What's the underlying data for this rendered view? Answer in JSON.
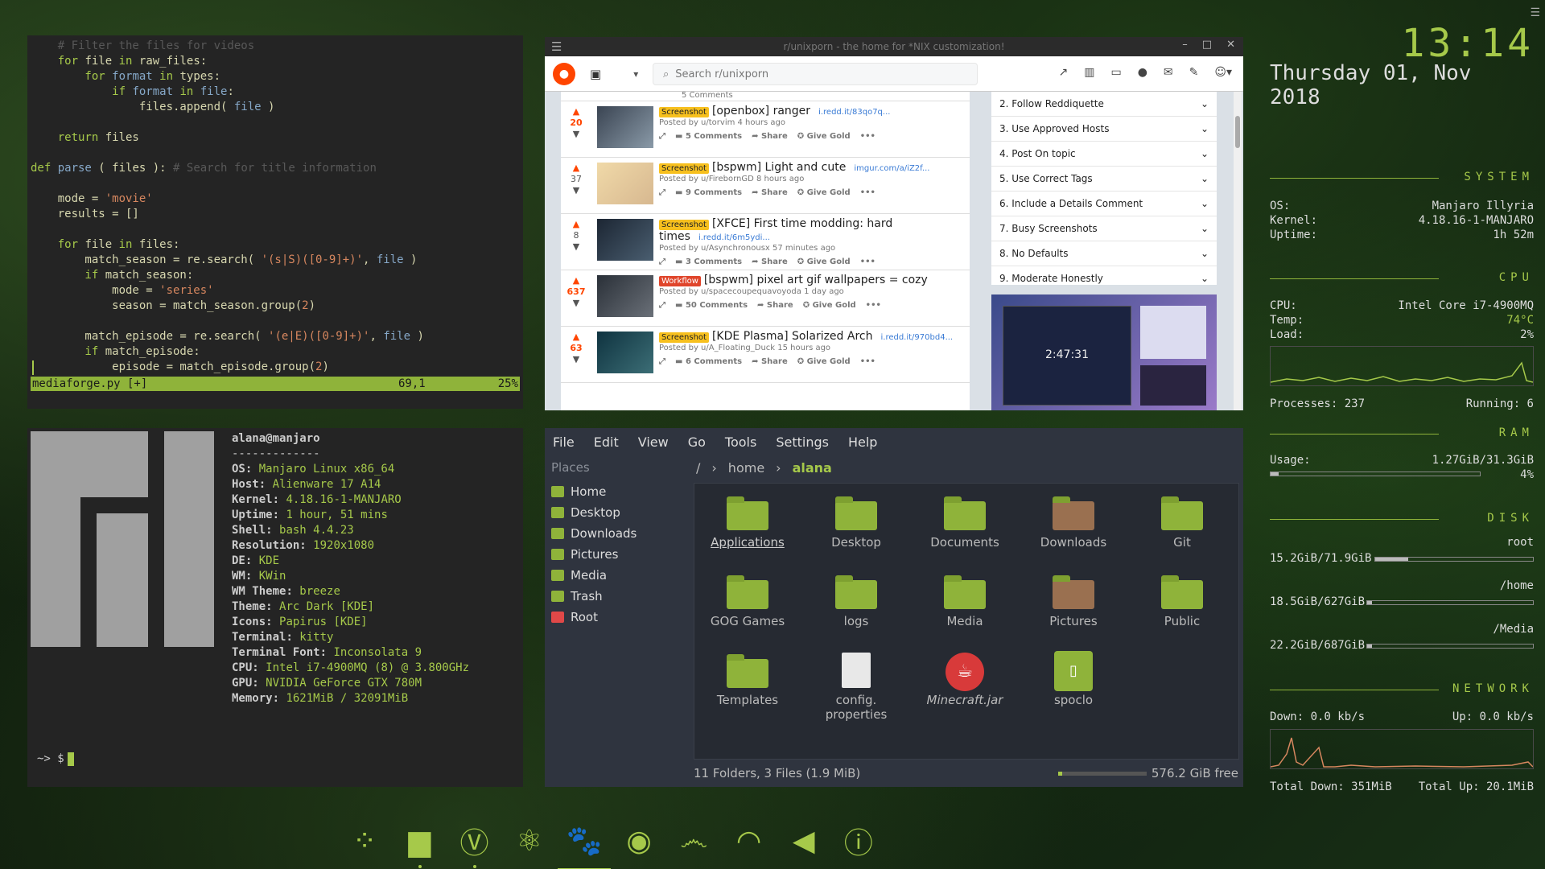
{
  "vim": {
    "lines": [
      [
        [
          "cm",
          "    # Filter the files for videos"
        ]
      ],
      [
        [
          "kw",
          "    for "
        ],
        [
          "",
          "file "
        ],
        [
          "kw",
          "in "
        ],
        [
          "",
          "raw_files:"
        ]
      ],
      [
        [
          "kw",
          "        for "
        ],
        [
          "fn",
          "format "
        ],
        [
          "kw",
          "in "
        ],
        [
          "",
          "types:"
        ]
      ],
      [
        [
          "kw",
          "            if "
        ],
        [
          "fn",
          "format "
        ],
        [
          "kw",
          "in "
        ],
        [
          "fn",
          "file"
        ],
        [
          "",
          ":"
        ]
      ],
      [
        [
          "",
          "                files.append( "
        ],
        [
          "fn",
          "file"
        ],
        [
          "",
          " )"
        ]
      ],
      [
        [
          "",
          ""
        ]
      ],
      [
        [
          "kw",
          "    return "
        ],
        [
          "",
          "files"
        ]
      ],
      [
        [
          "",
          ""
        ]
      ],
      [
        [
          "kw",
          "def "
        ],
        [
          "fn",
          "parse"
        ],
        [
          "",
          " ( files ): "
        ],
        [
          "cm",
          "# Search for title information"
        ]
      ],
      [
        [
          "",
          ""
        ]
      ],
      [
        [
          "",
          "    mode = "
        ],
        [
          "str",
          "'movie'"
        ]
      ],
      [
        [
          "",
          "    results = []"
        ]
      ],
      [
        [
          "",
          ""
        ]
      ],
      [
        [
          "kw",
          "    for "
        ],
        [
          "",
          "file "
        ],
        [
          "kw",
          "in "
        ],
        [
          "",
          "files:"
        ]
      ],
      [
        [
          "",
          "        match_season = re.search( "
        ],
        [
          "str",
          "'(s|S)([0-9]+)'"
        ],
        [
          "",
          ", "
        ],
        [
          "fn",
          "file"
        ],
        [
          "",
          " )"
        ]
      ],
      [
        [
          "kw",
          "        if "
        ],
        [
          "",
          "match_season:"
        ]
      ],
      [
        [
          "",
          "            mode = "
        ],
        [
          "str",
          "'series'"
        ]
      ],
      [
        [
          "",
          "            season = match_season.group("
        ],
        [
          "num",
          "2"
        ],
        [
          "",
          ")"
        ]
      ],
      [
        [
          "",
          ""
        ]
      ],
      [
        [
          "",
          "        match_episode = re.search( "
        ],
        [
          "str",
          "'(e|E)([0-9]+)'"
        ],
        [
          "",
          ", "
        ],
        [
          "fn",
          "file"
        ],
        [
          "",
          " )"
        ]
      ],
      [
        [
          "kw",
          "        if "
        ],
        [
          "",
          "match_episode:"
        ]
      ],
      [
        [
          "",
          "            episode = match_episode.group("
        ],
        [
          "num",
          "2"
        ],
        [
          "",
          ")"
        ]
      ]
    ],
    "status_file": "mediaforge.py [+]",
    "status_pos": "69,1",
    "status_pct": "25%"
  },
  "reddit": {
    "window_title": "r/unixporn - the home for *NIX customization!",
    "search_placeholder": "Search r/unixporn",
    "posts": [
      {
        "votes": "20",
        "hot": true,
        "flair": "Screenshot",
        "title": "[openbox] ranger",
        "domain": "i.redd.it/83qo7q...",
        "meta": "Posted by u/torvim 4 hours ago",
        "comments": "5 Comments"
      },
      {
        "votes": "37",
        "hot": false,
        "flair": "Screenshot",
        "title": "[bspwm] Light and cute",
        "domain": "imgur.com/a/iZ2f...",
        "meta": "Posted by u/FirebornGD 8 hours ago",
        "comments": "9 Comments"
      },
      {
        "votes": "8",
        "hot": false,
        "flair": "Screenshot",
        "title": "[XFCE] First time modding: hard times",
        "domain": "i.redd.it/6m5ydi...",
        "meta": "Posted by u/Asynchronousx 57 minutes ago",
        "comments": "3 Comments"
      },
      {
        "votes": "637",
        "hot": true,
        "flair": "Workflow",
        "title": "[bspwm] pixel art gif wallpapers = cozy",
        "domain": "",
        "meta": "Posted by u/spacecoupequavoyoda 1 day ago",
        "comments": "50 Comments"
      },
      {
        "votes": "63",
        "hot": true,
        "flair": "Screenshot",
        "title": "[KDE Plasma] Solarized Arch",
        "domain": "i.redd.it/970bd4...",
        "meta": "Posted by u/A_Floating_Duck 15 hours ago",
        "comments": "6 Comments"
      }
    ],
    "share": "Share",
    "give_gold": "Give Gold",
    "rules": [
      "2. Follow Reddiquette",
      "3. Use Approved Hosts",
      "4. Post On topic",
      "5. Use Correct Tags",
      "6. Include a Details Comment",
      "7. Busy Screenshots",
      "8. No Defaults",
      "9. Moderate Honestly"
    ],
    "banner_clock": "2:47:31",
    "top_partial_comments": "5 Comments"
  },
  "neofetch": {
    "user": "alana@manjaro",
    "sep": "-------------",
    "rows": [
      [
        "OS",
        "Manjaro Linux x86_64"
      ],
      [
        "Host",
        "Alienware 17 A14"
      ],
      [
        "Kernel",
        "4.18.16-1-MANJARO"
      ],
      [
        "Uptime",
        "1 hour, 51 mins"
      ],
      [
        "Shell",
        "bash 4.4.23"
      ],
      [
        "Resolution",
        "1920x1080"
      ],
      [
        "DE",
        "KDE"
      ],
      [
        "WM",
        "KWin"
      ],
      [
        "WM Theme",
        "breeze"
      ],
      [
        "Theme",
        "Arc Dark [KDE]"
      ],
      [
        "Icons",
        "Papirus [KDE]"
      ],
      [
        "Terminal",
        "kitty"
      ],
      [
        "Terminal Font",
        "Inconsolata 9"
      ],
      [
        "CPU",
        "Intel i7-4900MQ (8) @ 3.800GHz"
      ],
      [
        "GPU",
        "NVIDIA GeForce GTX 780M"
      ],
      [
        "Memory",
        "1621MiB / 32091MiB"
      ]
    ],
    "prompt": "~> $"
  },
  "files": {
    "menu": [
      "File",
      "Edit",
      "View",
      "Go",
      "Tools",
      "Settings",
      "Help"
    ],
    "places_header": "Places",
    "places": [
      "Home",
      "Desktop",
      "Downloads",
      "Pictures",
      "Media",
      "Trash",
      "Root"
    ],
    "crumb_root": "/",
    "crumb_home": "home",
    "crumb_current": "alana",
    "items": [
      "Applications",
      "Desktop",
      "Documents",
      "Downloads",
      "Git",
      "GOG Games",
      "logs",
      "Media",
      "Pictures",
      "Public",
      "Templates",
      "config.\nproperties",
      "Minecraft.jar",
      "spoclo"
    ],
    "status": "11 Folders, 3 Files (1.9 MiB)",
    "free": "576.2 GiB free",
    "free_fraction": 0.05
  },
  "conky": {
    "time": "13:14",
    "date": "Thursday 01, Nov 2018",
    "system_title": "SYSTEM",
    "os_k": "OS:",
    "os_v": "Manjaro Illyria",
    "kernel_k": "Kernel:",
    "kernel_v": "4.18.16-1-MANJARO",
    "uptime_k": "Uptime:",
    "uptime_v": "1h 52m",
    "cpu_title": "CPU",
    "cpu_k": "CPU:",
    "cpu_v": "Intel Core i7-4900MQ",
    "temp_k": "Temp:",
    "temp_v": "74°C",
    "load_k": "Load:",
    "load_v": "2%",
    "proc_k": "Processes: 237",
    "run_k": "Running: 6",
    "ram_title": "RAM",
    "usage_k": "Usage:",
    "usage_v": "1.27GiB/31.3GiB",
    "usage_pct": "4%",
    "usage_fraction": 0.04,
    "disk_title": "DISK",
    "disks": [
      {
        "mount": "root",
        "used": "15.2GiB/71.9GiB",
        "fraction": 0.21
      },
      {
        "mount": "/home",
        "used": "18.5GiB/627GiB",
        "fraction": 0.03
      },
      {
        "mount": "/Media",
        "used": "22.2GiB/687GiB",
        "fraction": 0.03
      }
    ],
    "net_title": "NETWORK",
    "down_k": "Down: 0.0 kb/s",
    "up_k": "Up: 0.0 kb/s",
    "total_down": "Total Down: 351MiB",
    "total_up": "Total Up: 20.1MiB"
  },
  "dock": [
    "kdeconnect-icon",
    "files-icon",
    "vivaldi-icon",
    "atom-icon",
    "paw-icon",
    "spotify-icon",
    "mustache-icon",
    "wifi-icon",
    "volume-muted-icon",
    "notifications-icon"
  ],
  "colors": {
    "accent": "#a6c94a",
    "reddit": "#ff4500"
  }
}
